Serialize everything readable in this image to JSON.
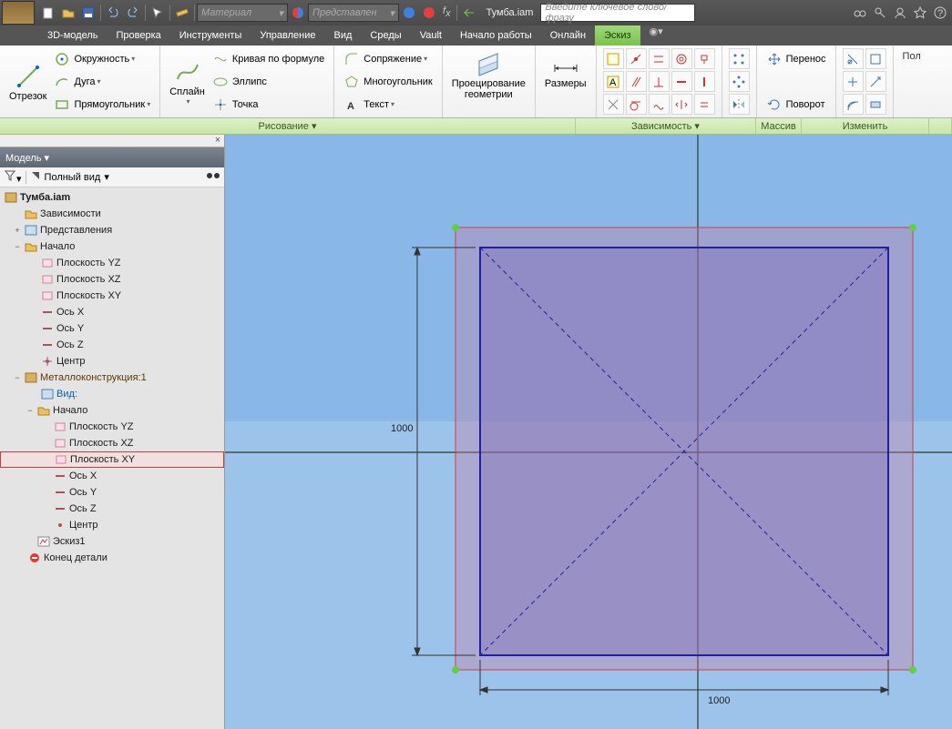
{
  "title_doc": "Тумба.iam",
  "qat": {
    "material_placeholder": "Материал",
    "appearance_placeholder": "Представлен",
    "search_placeholder": "Введите ключевое слово/фразу"
  },
  "menu": {
    "items": [
      "3D-модель",
      "Проверка",
      "Инструменты",
      "Управление",
      "Вид",
      "Среды",
      "Vault",
      "Начало работы",
      "Онлайн",
      "Эскиз"
    ],
    "active_index": 9
  },
  "ribbon": {
    "line_big": "Отрезок",
    "circle": "Окружность",
    "arc": "Дуга",
    "rect": "Прямоугольник",
    "spline_big": "Сплайн",
    "equation": "Кривая по формуле",
    "ellipse": "Эллипс",
    "point": "Точка",
    "fillet": "Сопряжение",
    "polygon": "Многоугольник",
    "text": "Текст",
    "project_big1": "Проецирование",
    "project_big2": "геометрии",
    "dimension": "Размеры",
    "move": "Перенос",
    "rotate": "Поворот",
    "array_label": "Массив"
  },
  "panels": {
    "draw": "Рисование ▾",
    "constraint": "Зависимость ▾",
    "array": "Массив",
    "modify": "Изменить",
    "more": "Пол"
  },
  "browser": {
    "header": "Модель ▾",
    "fullview": "Полный вид",
    "root": "Тумба.iam",
    "deps": "Зависимости",
    "views": "Представления",
    "origin": "Начало",
    "plane_yz": "Плоскость YZ",
    "plane_xz": "Плоскость XZ",
    "plane_xy": "Плоскость XY",
    "axis_x": "Ось X",
    "axis_y": "Ось Y",
    "axis_z": "Ось Z",
    "center": "Центр",
    "metal": "Металлоконструкция:1",
    "viewcolon": "Вид:",
    "sketch1": "Эскиз1",
    "endpart": "Конец детали"
  },
  "sketch": {
    "dim_v": "1000",
    "dim_h": "1000"
  }
}
